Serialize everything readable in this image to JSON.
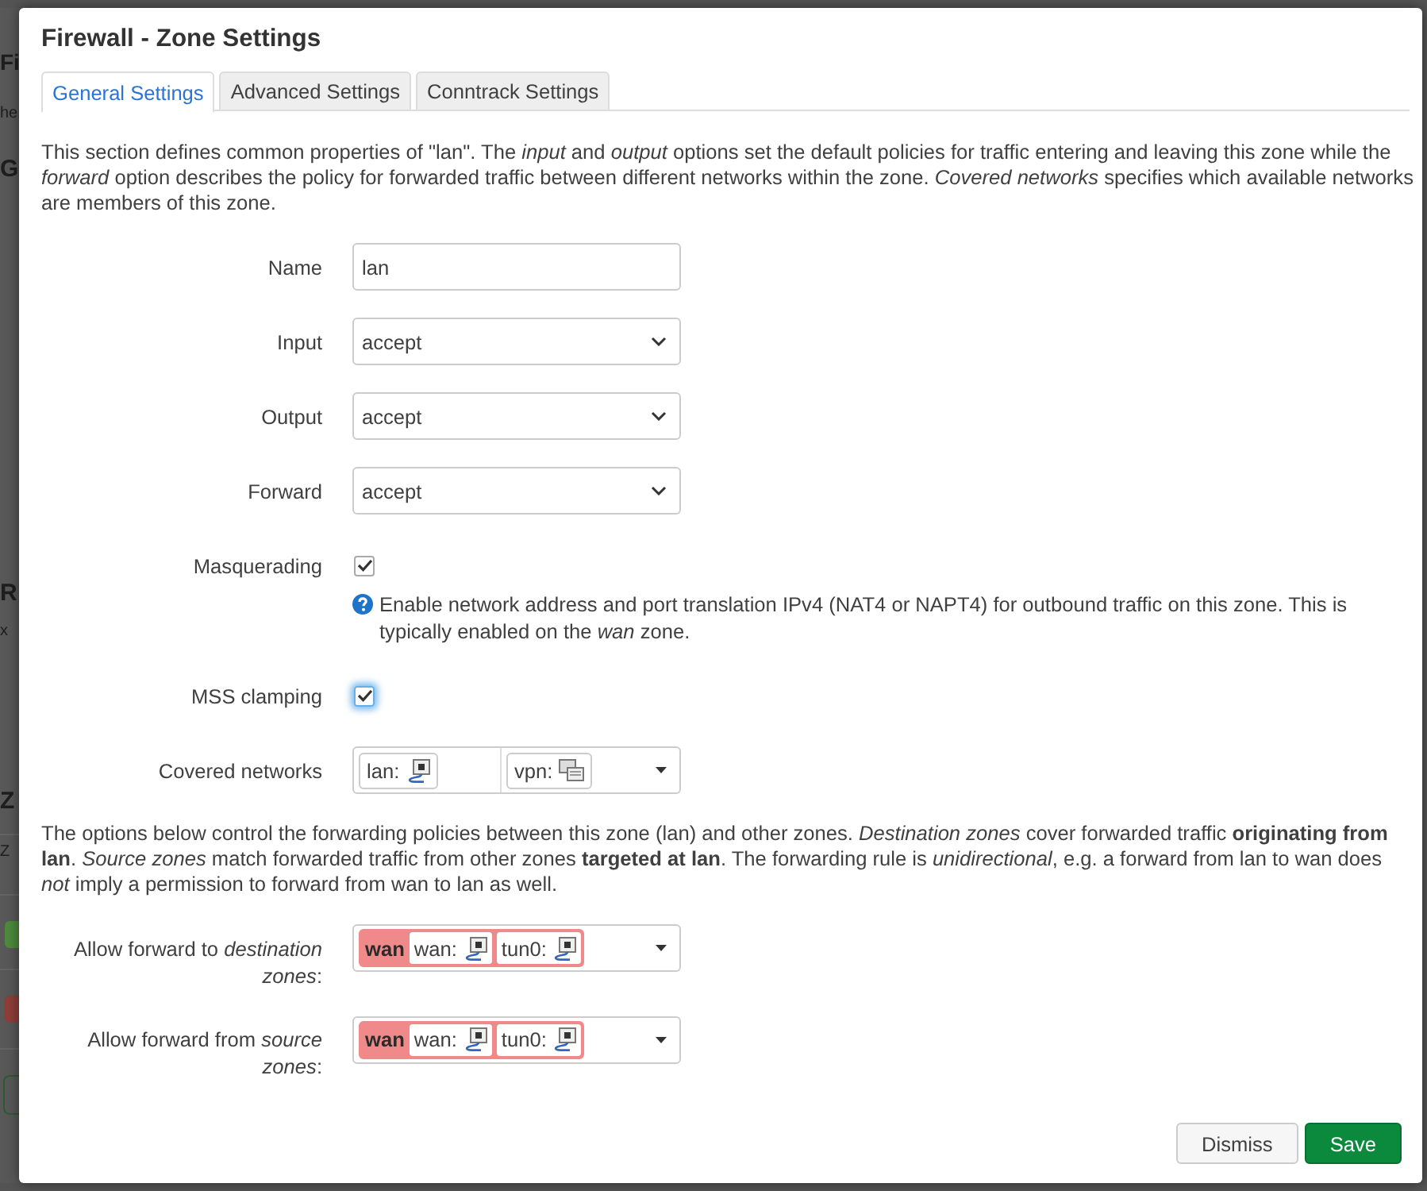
{
  "backdrop": {
    "fragments": [
      {
        "kind": "heading",
        "text": "Fi"
      },
      {
        "kind": "text",
        "text": "he"
      },
      {
        "kind": "subheading",
        "text": "G"
      },
      {
        "kind": "subheading",
        "text": "R"
      },
      {
        "kind": "text",
        "text": "x"
      },
      {
        "kind": "subheading",
        "text": "Z"
      },
      {
        "kind": "text",
        "text": "Z"
      },
      {
        "kind": "badge",
        "color": "#4e8a3e"
      },
      {
        "kind": "badge",
        "color": "#8e3e38"
      },
      {
        "kind": "outline"
      }
    ]
  },
  "dialog": {
    "title": "Firewall - Zone Settings"
  },
  "tabs": [
    {
      "label": "General Settings",
      "selected": true
    },
    {
      "label": "Advanced Settings",
      "selected": false
    },
    {
      "label": "Conntrack Settings",
      "selected": false
    }
  ],
  "description": "This section defines common properties of \"lan\". The *input* and *output* options set the default policies for traffic entering and leaving this zone while the *forward* option describes the policy for forwarded traffic between different networks within the zone. *Covered networks* specifies which available networks are members of this zone.",
  "fields": [
    {
      "kind": "text",
      "label": "Name",
      "value": "lan"
    },
    {
      "kind": "select",
      "label": "Input",
      "value": "accept"
    },
    {
      "kind": "select",
      "label": "Output",
      "value": "accept"
    },
    {
      "kind": "select",
      "label": "Forward",
      "value": "accept"
    },
    {
      "kind": "checkbox",
      "label": "Masquerading",
      "checked": true,
      "focused": false,
      "help": "Enable network address and port translation IPv4 (NAT4 or NAPT4) for outbound traffic on this zone. This is typically enabled on the *wan* zone."
    },
    {
      "kind": "checkbox",
      "label": "MSS clamping",
      "checked": true,
      "focused": true
    },
    {
      "kind": "networks",
      "label": "Covered networks",
      "networks": [
        {
          "name": "lan:",
          "kind": "port"
        },
        {
          "name": "vpn:",
          "kind": "virtual"
        }
      ]
    }
  ],
  "forwarding_note": "The options below control the forwarding policies between this zone (lan) and other zones. *Destination zones* cover forwarded traffic **originating from lan**. *Source zones* match forwarded traffic from other zones **targeted at lan**. The forwarding rule is *unidirectional*, e.g. a forward from lan to wan does *not* imply a permission to forward from wan to lan as well.",
  "forwarding": [
    {
      "label": "Allow forward to *destination zones*:",
      "zones": [
        {
          "name": "wan",
          "color": "#f08a8a",
          "networks": [
            {
              "name": "wan:",
              "kind": "port"
            },
            {
              "name": "tun0:",
              "kind": "port"
            }
          ]
        }
      ]
    },
    {
      "label": "Allow forward from *source zones*:",
      "zones": [
        {
          "name": "wan",
          "color": "#f08a8a",
          "networks": [
            {
              "name": "wan:",
              "kind": "port"
            },
            {
              "name": "tun0:",
              "kind": "port"
            }
          ]
        }
      ]
    }
  ],
  "buttons": [
    {
      "label": "Dismiss",
      "kind": "secondary"
    },
    {
      "label": "Save",
      "kind": "primary"
    }
  ]
}
